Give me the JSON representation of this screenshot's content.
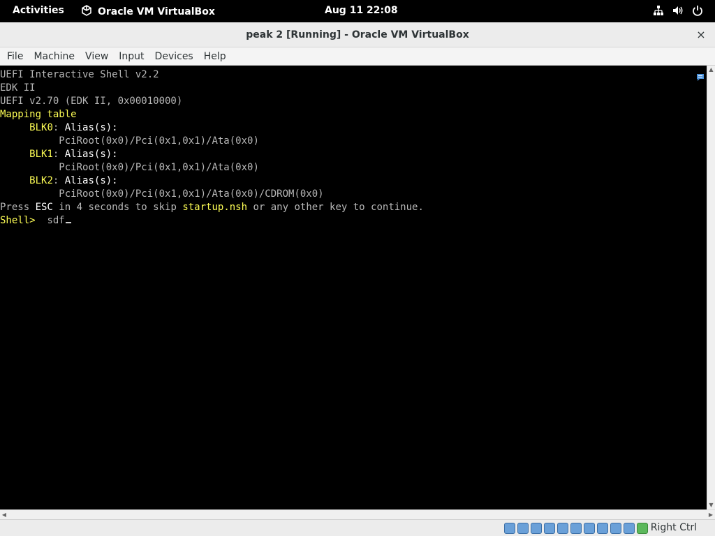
{
  "topbar": {
    "activities": "Activities",
    "app_name": "Oracle VM VirtualBox",
    "clock": "Aug 11  22:08"
  },
  "window": {
    "title": "peak 2 [Running] - Oracle VM VirtualBox",
    "close_symbol": "×"
  },
  "menu": {
    "file": "File",
    "machine": "Machine",
    "view": "View",
    "input": "Input",
    "devices": "Devices",
    "help": "Help"
  },
  "console": {
    "line1": "UEFI Interactive Shell v2.2",
    "line2": "EDK II",
    "line3": "UEFI v2.70 (EDK II, 0x00010000)",
    "mapping_table": "Mapping table",
    "blk0": "BLK0",
    "blk1": "BLK1",
    "blk2": "BLK2",
    "colon": ":",
    "alias": " Alias(s):",
    "path0": "PciRoot(0x0)/Pci(0x1,0x1)/Ata(0x0)",
    "path1": "PciRoot(0x0)/Pci(0x1,0x1)/Ata(0x0)",
    "path2": "PciRoot(0x0)/Pci(0x1,0x1)/Ata(0x0)/CDROM(0x0)",
    "press": "Press ",
    "esc": "ESC",
    "in_seconds": " in 4 seconds to skip ",
    "startup": "startup.nsh",
    "continue": " or any other key to continue.",
    "prompt": "Shell>",
    "typed": "sdf"
  },
  "statusbar": {
    "host_key": "Right Ctrl"
  },
  "icons": {
    "app": "virtualbox-cube-icon",
    "network": "network-icon",
    "volume": "volume-icon",
    "power": "power-icon",
    "close": "close-icon"
  }
}
